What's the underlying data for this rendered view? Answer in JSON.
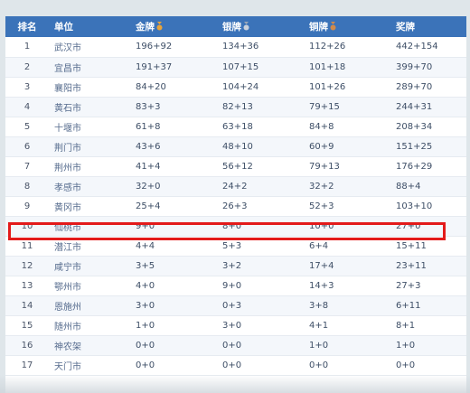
{
  "table": {
    "headers": {
      "rank": "排名",
      "unit": "单位",
      "gold": "金牌",
      "silver": "银牌",
      "bronze": "铜牌",
      "medals": "奖牌"
    },
    "rows": [
      {
        "rank": "1",
        "city": "武汉市",
        "gold": "196+92",
        "silver": "134+36",
        "bronze": "112+26",
        "total": "442+154"
      },
      {
        "rank": "2",
        "city": "宜昌市",
        "gold": "191+37",
        "silver": "107+15",
        "bronze": "101+18",
        "total": "399+70"
      },
      {
        "rank": "3",
        "city": "襄阳市",
        "gold": "84+20",
        "silver": "104+24",
        "bronze": "101+26",
        "total": "289+70"
      },
      {
        "rank": "4",
        "city": "黄石市",
        "gold": "83+3",
        "silver": "82+13",
        "bronze": "79+15",
        "total": "244+31"
      },
      {
        "rank": "5",
        "city": "十堰市",
        "gold": "61+8",
        "silver": "63+18",
        "bronze": "84+8",
        "total": "208+34"
      },
      {
        "rank": "6",
        "city": "荆门市",
        "gold": "43+6",
        "silver": "48+10",
        "bronze": "60+9",
        "total": "151+25"
      },
      {
        "rank": "7",
        "city": "荆州市",
        "gold": "41+4",
        "silver": "56+12",
        "bronze": "79+13",
        "total": "176+29"
      },
      {
        "rank": "8",
        "city": "孝感市",
        "gold": "32+0",
        "silver": "24+2",
        "bronze": "32+2",
        "total": "88+4"
      },
      {
        "rank": "9",
        "city": "黄冈市",
        "gold": "25+4",
        "silver": "26+3",
        "bronze": "52+3",
        "total": "103+10"
      },
      {
        "rank": "10",
        "city": "仙桃市",
        "gold": "9+0",
        "silver": "8+0",
        "bronze": "10+0",
        "total": "27+0"
      },
      {
        "rank": "11",
        "city": "潜江市",
        "gold": "4+4",
        "silver": "5+3",
        "bronze": "6+4",
        "total": "15+11"
      },
      {
        "rank": "12",
        "city": "咸宁市",
        "gold": "3+5",
        "silver": "3+2",
        "bronze": "17+4",
        "total": "23+11"
      },
      {
        "rank": "13",
        "city": "鄂州市",
        "gold": "4+0",
        "silver": "9+0",
        "bronze": "14+3",
        "total": "27+3"
      },
      {
        "rank": "14",
        "city": "恩施州",
        "gold": "3+0",
        "silver": "0+3",
        "bronze": "3+8",
        "total": "6+11"
      },
      {
        "rank": "15",
        "city": "随州市",
        "gold": "1+0",
        "silver": "3+0",
        "bronze": "4+1",
        "total": "8+1"
      },
      {
        "rank": "16",
        "city": "神农架",
        "gold": "0+0",
        "silver": "0+0",
        "bronze": "1+0",
        "total": "1+0"
      },
      {
        "rank": "17",
        "city": "天门市",
        "gold": "0+0",
        "silver": "0+0",
        "bronze": "0+0",
        "total": "0+0"
      }
    ]
  },
  "colors": {
    "header_bg": "#3b73b9",
    "highlight_border": "#e31a1a",
    "gold": "#e8a43a",
    "silver": "#9aa7b8",
    "bronze": "#d08a4a"
  },
  "icons": [
    "gold-medal-icon",
    "silver-medal-icon",
    "bronze-medal-icon"
  ]
}
